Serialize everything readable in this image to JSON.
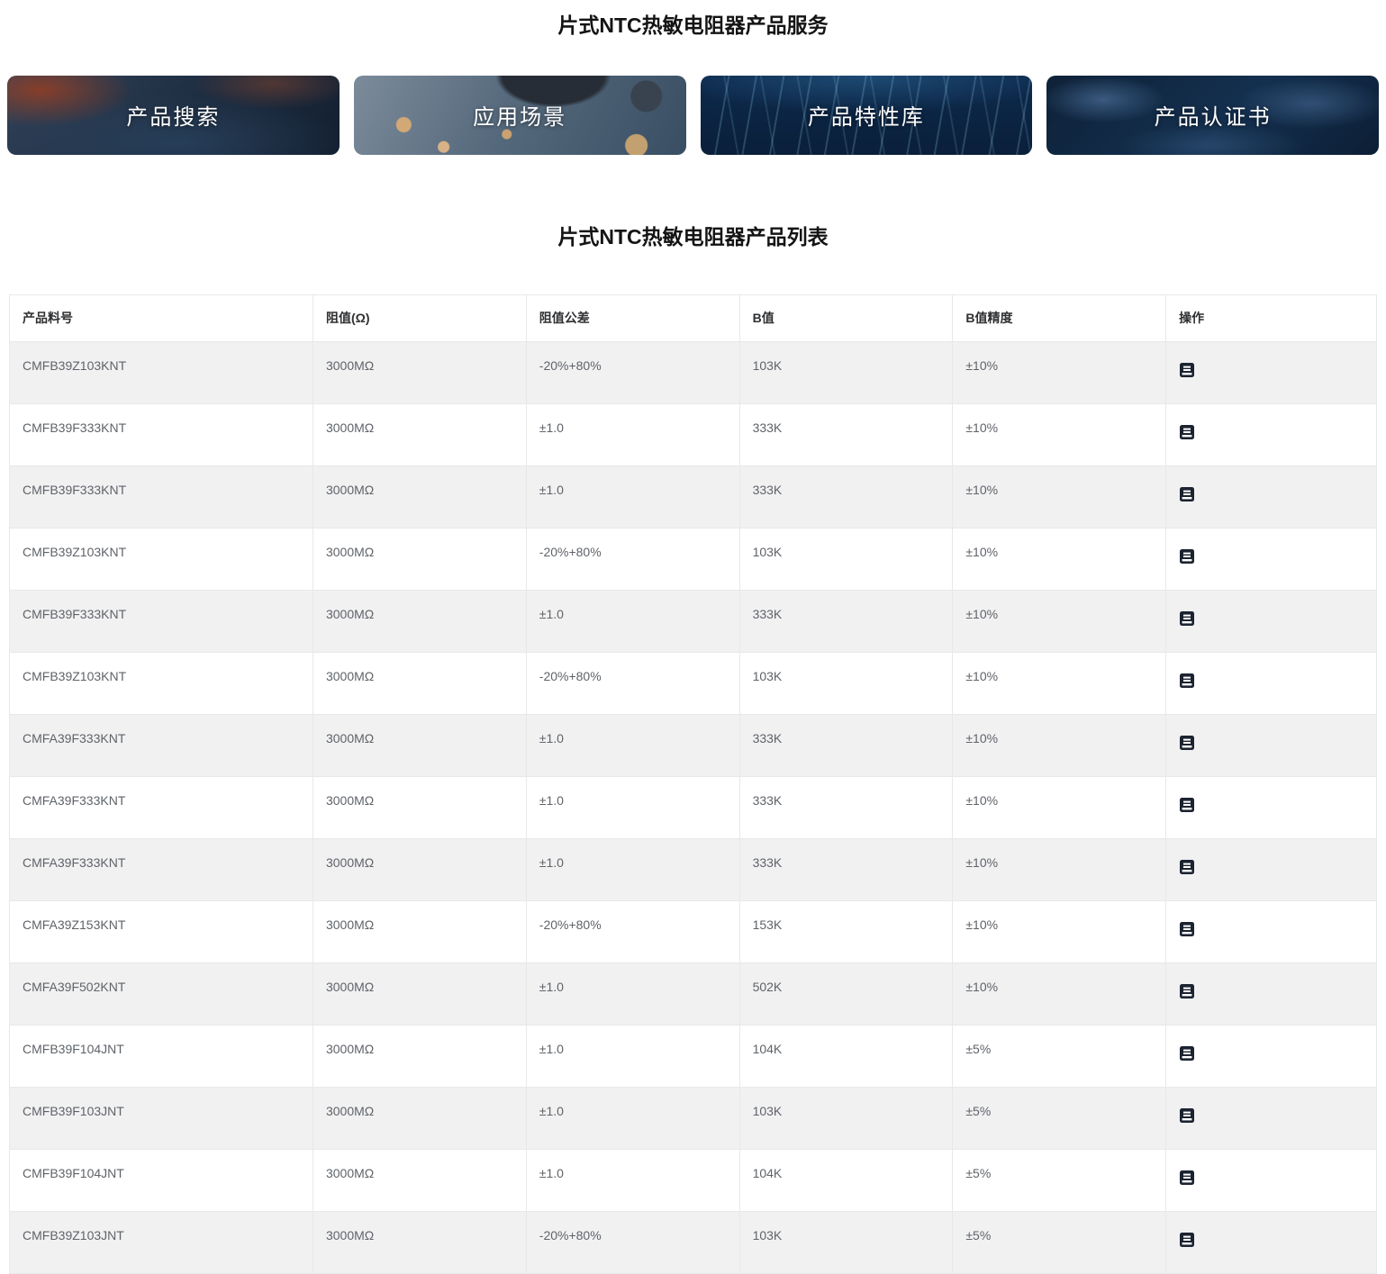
{
  "page": {
    "services_title": "片式NTC热敏电阻器产品服务",
    "list_title": "片式NTC热敏电阻器产品列表"
  },
  "nav_banners": [
    {
      "label": "产品搜索"
    },
    {
      "label": "应用场景"
    },
    {
      "label": "产品特性库"
    },
    {
      "label": "产品认证书"
    }
  ],
  "table": {
    "columns": [
      "产品料号",
      "阻值(Ω)",
      "阻值公差",
      "B值",
      "B值精度",
      "操作"
    ],
    "action_icon": "document-list-icon",
    "rows": [
      [
        "CMFB39Z103KNT",
        "3000MΩ",
        "-20%+80%",
        "103K",
        "±10%"
      ],
      [
        "CMFB39F333KNT",
        "3000MΩ",
        "±1.0",
        "333K",
        "±10%"
      ],
      [
        "CMFB39F333KNT",
        "3000MΩ",
        "±1.0",
        "333K",
        "±10%"
      ],
      [
        "CMFB39Z103KNT",
        "3000MΩ",
        "-20%+80%",
        "103K",
        "±10%"
      ],
      [
        "CMFB39F333KNT",
        "3000MΩ",
        "±1.0",
        "333K",
        "±10%"
      ],
      [
        "CMFB39Z103KNT",
        "3000MΩ",
        "-20%+80%",
        "103K",
        "±10%"
      ],
      [
        "CMFA39F333KNT",
        "3000MΩ",
        "±1.0",
        "333K",
        "±10%"
      ],
      [
        "CMFA39F333KNT",
        "3000MΩ",
        "±1.0",
        "333K",
        "±10%"
      ],
      [
        "CMFA39F333KNT",
        "3000MΩ",
        "±1.0",
        "333K",
        "±10%"
      ],
      [
        "CMFA39Z153KNT",
        "3000MΩ",
        "-20%+80%",
        "153K",
        "±10%"
      ],
      [
        "CMFA39F502KNT",
        "3000MΩ",
        "±1.0",
        "502K",
        "±10%"
      ],
      [
        "CMFB39F104JNT",
        "3000MΩ",
        "±1.0",
        "104K",
        "±5%"
      ],
      [
        "CMFB39F103JNT",
        "3000MΩ",
        "±1.0",
        "103K",
        "±5%"
      ],
      [
        "CMFB39F104JNT",
        "3000MΩ",
        "±1.0",
        "104K",
        "±5%"
      ],
      [
        "CMFB39Z103JNT",
        "3000MΩ",
        "-20%+80%",
        "103K",
        "±5%"
      ]
    ]
  },
  "colors": {
    "stripe_row_bg": "#f1f1f2",
    "table_border": "#e7e8ea",
    "header_text": "#2e2f31",
    "cell_text": "#5f6368",
    "banner_text": "#ffffff",
    "action_icon_fill": "#1c2330"
  }
}
